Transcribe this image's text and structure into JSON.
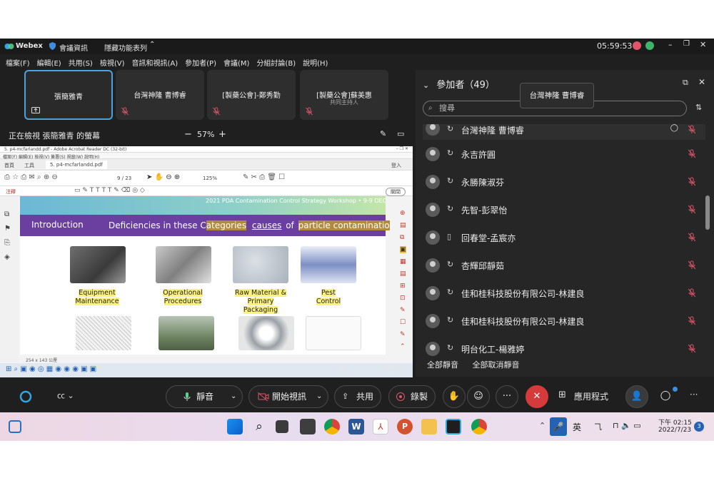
{
  "titlebar": {
    "app_name": "Webex",
    "meeting_info": "會議資訊",
    "hidden_functions": "隱藏功能表列",
    "clock": "05:59:53"
  },
  "menubar": {
    "items": [
      "檔案(F)",
      "編輯(E)",
      "共用(S)",
      "檢視(V)",
      "音訊和視訊(A)",
      "參加者(P)",
      "會議(M)",
      "分組討論(B)",
      "說明(H)"
    ]
  },
  "video_tiles": [
    {
      "name": "張簡雅青",
      "subtitle": ""
    },
    {
      "name": "台灣神隆 曹博睿",
      "subtitle": ""
    },
    {
      "name": "[製藥公會]-鄭秀勤",
      "subtitle": ""
    },
    {
      "name": "[製藥公會]蘇美惠",
      "subtitle": "共同主持人"
    }
  ],
  "share_bar": {
    "viewing_text": "正在檢視 張簡雅青 的螢幕",
    "zoom": "57%",
    "zoom_minus": "−",
    "zoom_plus": "+"
  },
  "shared_screen": {
    "window_title": "5. p4-mcfarlandd.pdf - Adobe Acrobat Reader DC (32-bit)",
    "pdf_menu": "檔案(F)  編輯(E)  檢視(V)  簽署(S)  視窗(W)  說明(H)",
    "tabs": [
      "首頁",
      "工具",
      "5. p4-mcfarlandd.pdf"
    ],
    "login": "登入",
    "page_indicator": "9 / 23",
    "zoom_level": "125%",
    "comment_label": "注釋",
    "close_label": "關閉",
    "page_size": "254 x 143 公厘",
    "mini_clock": "下午 02:15",
    "mini_date": "2022/7/23",
    "mini_lang": "英",
    "slide": {
      "header": "2021 PDA Contamination Control Strategy Workshop • 9-9 DEC",
      "band_left": "Introduction",
      "band_text_1": "Deficiencies in these C",
      "band_text_2": "ategories",
      "band_text_3": "causes",
      "band_text_4": "of",
      "band_text_5": "particle contaminatio",
      "labels": [
        [
          "Equipment",
          "Maintenance"
        ],
        [
          "Operational",
          "Procedures"
        ],
        [
          "Raw Material &",
          "Primary",
          "Packaging"
        ],
        [
          "Pest",
          "Control"
        ]
      ]
    }
  },
  "panel": {
    "title": "參加者（49）",
    "search_placeholder": "搜尋",
    "tooltip": "台灣神隆 曹博睿",
    "participants": [
      "台灣神隆 曹博睿",
      "永吉許圓",
      "永勝陳淑芬",
      "先智-彭翠怡",
      "回春堂-孟宸亦",
      "杏輝邱靜茹",
      "佳和桂科技股份有限公司-林建良",
      "佳和桂科技股份有限公司-林建良",
      "明台化工-楊雅婷"
    ],
    "mute_all": "全部靜音",
    "unmute_all": "全部取消靜音"
  },
  "controls": {
    "mute": "靜音",
    "start_video": "開始視訊",
    "share": "共用",
    "record": "錄製",
    "more": "···",
    "apps": "應用程式"
  },
  "win_taskbar": {
    "lang": "英",
    "time": "下午 02:15",
    "date": "2022/7/23",
    "notif_count": "3"
  },
  "colors": {
    "accent_blue": "#4aa3df",
    "mute_red": "#e0556a",
    "end_call": "#d63b3b",
    "slide_band": "#6a3fa0",
    "highlight": "#fbf27a"
  }
}
